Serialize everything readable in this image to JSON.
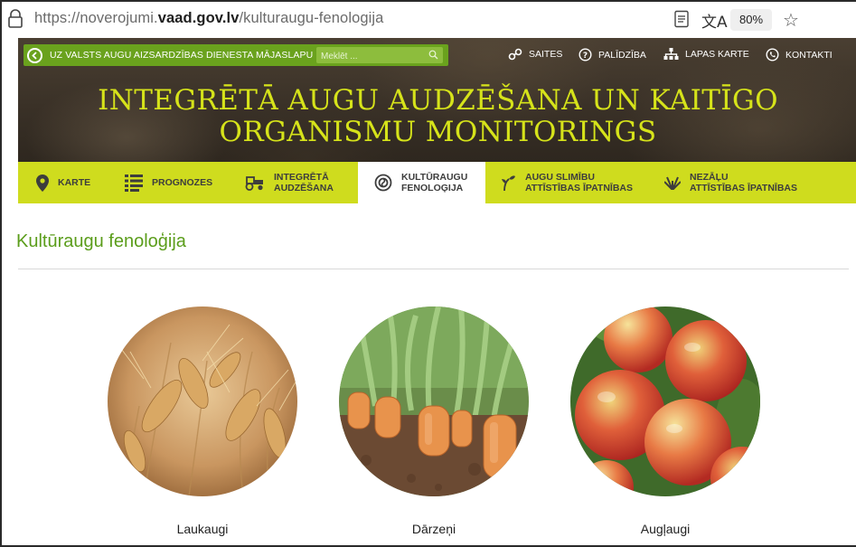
{
  "browser": {
    "url_prefix": "https://noverojumi.",
    "url_domain": "vaad.gov.lv",
    "url_path": "/kulturaugu-fenologija",
    "zoom": "80%"
  },
  "topbar": {
    "back_label": "UZ VALSTS AUGU AIZSARDZĪBAS DIENESTA MĀJASLAPU",
    "search_placeholder": "Meklēt ...",
    "links": {
      "saites": "SAITES",
      "palidziba": "PALĪDZĪBA",
      "lapas_karte": "LAPAS KARTE",
      "kontakti": "KONTAKTI"
    }
  },
  "header": {
    "title_line1": "INTEGRĒTĀ AUGU AUDZĒŠANA UN KAITĪGO",
    "title_line2": "ORGANISMU MONITORINGS"
  },
  "nav": {
    "items": [
      {
        "l1": "KARTE",
        "l2": ""
      },
      {
        "l1": "PROGNOZES",
        "l2": ""
      },
      {
        "l1": "INTEGRĒTĀ",
        "l2": "AUDZĒŠANA"
      },
      {
        "l1": "KULTŪRAUGU",
        "l2": "FENOLOĢIJA"
      },
      {
        "l1": "AUGU SLIMĪBU",
        "l2": "ATTĪSTĪBAS ĪPATNĪBAS"
      },
      {
        "l1": "NEZĀĻU",
        "l2": "ATTĪSTĪBAS ĪPATNĪBAS"
      }
    ],
    "active_index": 3
  },
  "page": {
    "title": "Kultūraugu fenoloģija"
  },
  "crops": [
    {
      "label": "Laukaugi"
    },
    {
      "label": "Dārzeņi"
    },
    {
      "label": "Augļaugi"
    }
  ],
  "colors": {
    "accent_green": "#5b9d1b",
    "nav_yellow": "#cfdc1e",
    "title_yellow": "#d6e31a"
  }
}
